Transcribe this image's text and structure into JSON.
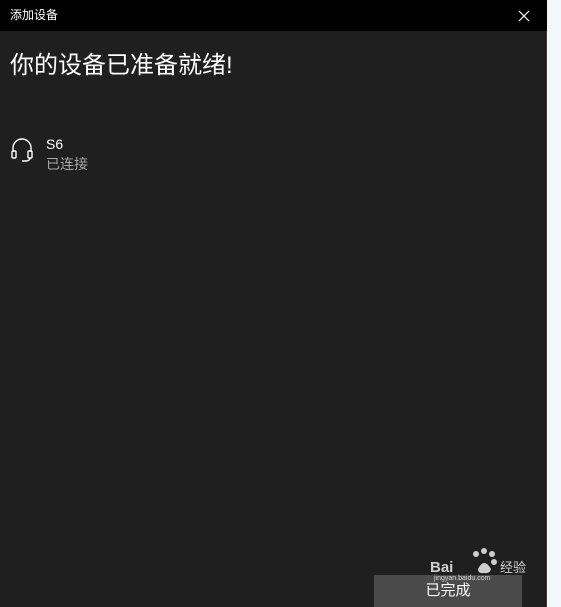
{
  "window": {
    "title": "添加设备",
    "close_icon": "close-icon"
  },
  "main": {
    "heading": "你的设备已准备就绪!",
    "devices": [
      {
        "name": "S6",
        "status": "已连接",
        "icon": "headset-icon"
      }
    ]
  },
  "footer": {
    "done_label": "已完成"
  },
  "colors": {
    "titlebar_bg": "#000000",
    "window_bg": "#1f1f1f",
    "button_bg": "#4a4a4a",
    "text_primary": "#ffffff",
    "text_secondary": "#a8a8a8"
  }
}
